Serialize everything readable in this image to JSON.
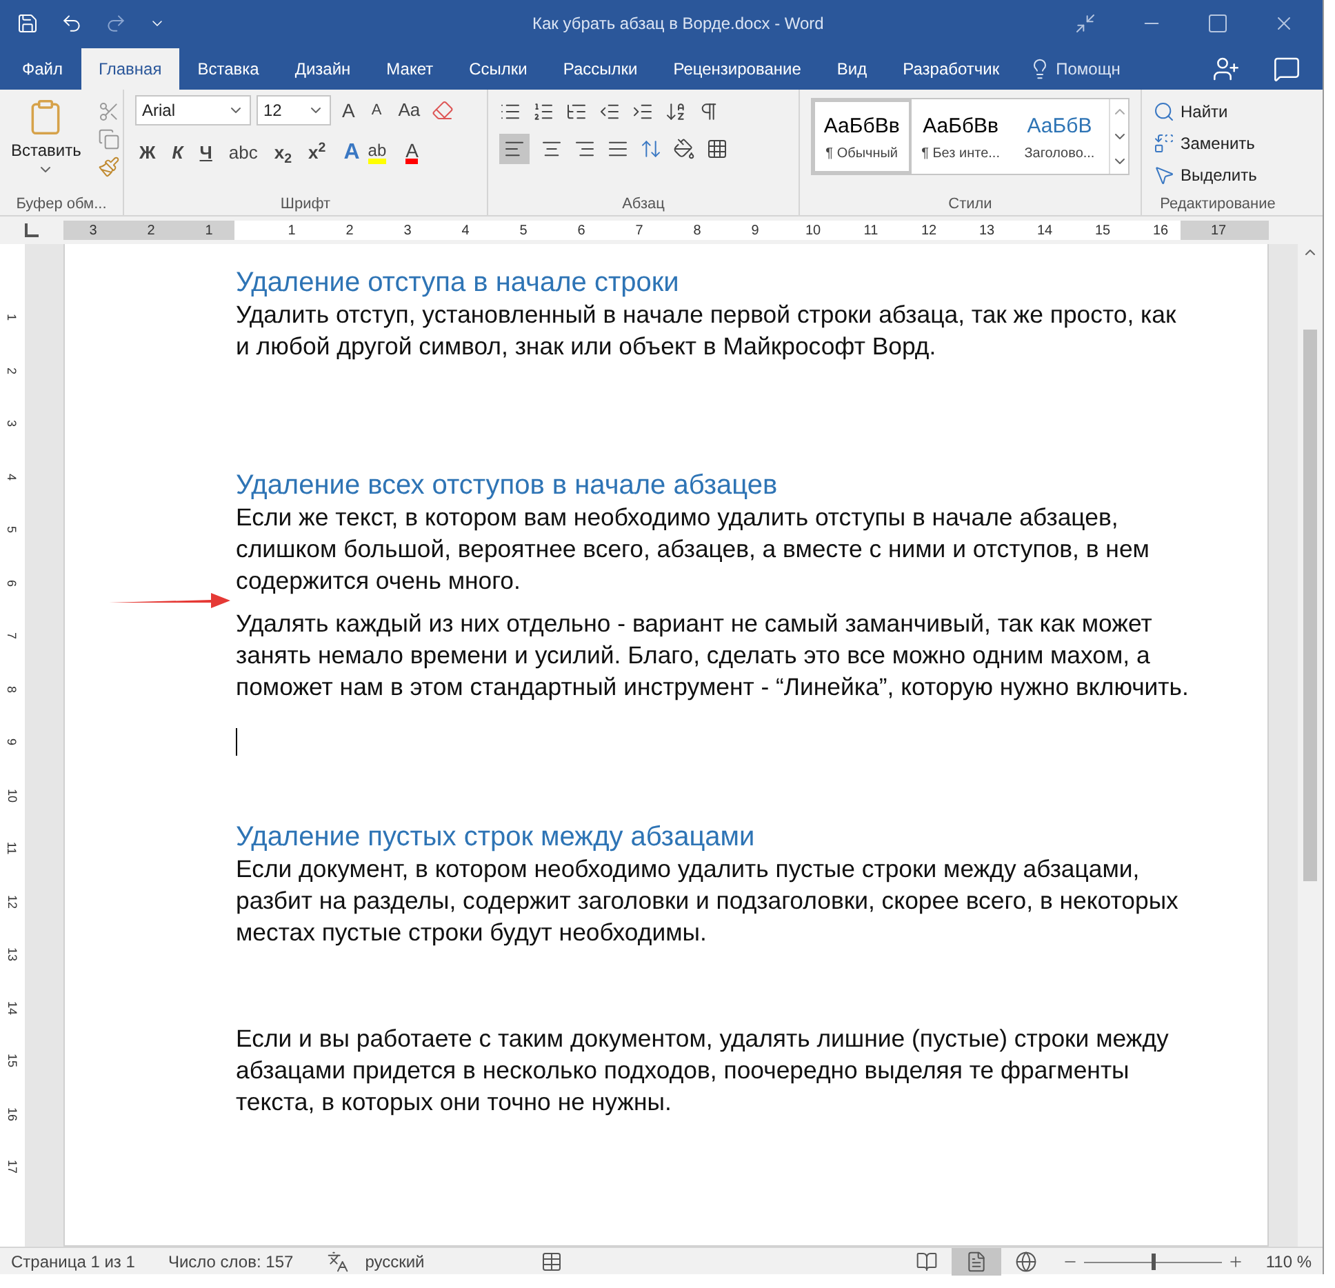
{
  "window": {
    "title": "Как убрать абзац в Ворде.docx - Word"
  },
  "tabs": [
    {
      "label": "Файл",
      "selected": false
    },
    {
      "label": "Главная",
      "selected": true
    },
    {
      "label": "Вставка",
      "selected": false
    },
    {
      "label": "Дизайн",
      "selected": false
    },
    {
      "label": "Макет",
      "selected": false
    },
    {
      "label": "Ссылки",
      "selected": false
    },
    {
      "label": "Рассылки",
      "selected": false
    },
    {
      "label": "Рецензирование",
      "selected": false
    },
    {
      "label": "Вид",
      "selected": false
    },
    {
      "label": "Разработчик",
      "selected": false
    }
  ],
  "tell_me": "Помощн",
  "clipboard": {
    "paste": "Вставить",
    "label": "Буфер обм..."
  },
  "font": {
    "name": "Arial",
    "size": "12",
    "size_buttons": [
      "A",
      "A",
      "Aa"
    ],
    "color_buttons": [
      "A",
      "ab",
      "A"
    ],
    "format_buttons": [
      "Ж",
      "К",
      "Ч",
      "abc",
      "x$_{2}$",
      "x$^{2}$"
    ],
    "label": "Шрифт"
  },
  "paragraph": {
    "label": "Абзац"
  },
  "styles": {
    "label": "Стили",
    "items": [
      {
        "sample": "АаБбВв",
        "name": "¶ Обычный",
        "kind": "normal",
        "selected": true
      },
      {
        "sample": "АаБбВв",
        "name": "¶ Без инте...",
        "kind": "normal",
        "selected": false
      },
      {
        "sample": "АаБбВ",
        "name": "Заголово...",
        "kind": "heading",
        "selected": false
      }
    ]
  },
  "editing": {
    "label": "Редактирование",
    "items": [
      "Найти",
      "Заменить",
      "Выделить"
    ]
  },
  "ruler": [
    "3",
    "2",
    "1",
    "1",
    "2",
    "3",
    "4",
    "5",
    "6",
    "7",
    "8",
    "9",
    "10",
    "11",
    "12",
    "13",
    "14",
    "15",
    "16",
    "17"
  ],
  "vertical_ruler": [
    "1",
    "2",
    "3",
    "4",
    "5",
    "6",
    "7",
    "8",
    "9",
    "10",
    "11",
    "12",
    "13",
    "14",
    "15",
    "16",
    "17"
  ],
  "document": [
    {
      "kind": "heading",
      "text": "Удаление отступа в начале строки"
    },
    {
      "kind": "paragraph",
      "text": "Удалить отступ, установленный в начале первой строки абзаца, так же просто, как и любой другой символ, знак или объект в Майкрософт Ворд.",
      "marked": false
    },
    {
      "kind": "blank"
    },
    {
      "kind": "blank"
    },
    {
      "kind": "blank"
    },
    {
      "kind": "heading",
      "text": "Удаление всех отступов в начале абзацев"
    },
    {
      "kind": "paragraph",
      "text": "Если же текст, в котором вам необходимо удалить отступы в начале абзацев, слишком большой, вероятнее всего, абзацев, а вместе с ними и отступов, в нем содержится очень много.",
      "marked": false
    },
    {
      "kind": "paragraph",
      "text": "Удалять каждый из них отдельно - вариант не самый заманчивый, так как может занять немало времени и усилий. Благо, сделать это все можно одним махом, а поможет нам в этом стандартный инструмент - “Линейка”, которую нужно включить.",
      "marked": true
    },
    {
      "kind": "cursor"
    },
    {
      "kind": "blank"
    },
    {
      "kind": "blank"
    },
    {
      "kind": "heading",
      "text": "Удаление пустых строк между абзацами"
    },
    {
      "kind": "paragraph",
      "text": "Если документ, в котором необходимо удалить пустые строки между абзацами, разбит на разделы, содержит заголовки и подзаголовки, скорее всего, в некоторых местах пустые строки будут необходимы.",
      "marked": false
    },
    {
      "kind": "blank"
    },
    {
      "kind": "blank"
    },
    {
      "kind": "paragraph",
      "text": "Если и вы работаете с таким документом, удалять лишние (пустые) строки между абзацами придется в несколько подходов, поочередно выделяя те фрагменты текста, в которых они точно не нужны.",
      "marked": false
    }
  ],
  "status_bar": {
    "page": "Страница 1 из 1",
    "words": "Число слов: 157",
    "language": "русский",
    "views": [
      {
        "kind": "read",
        "selected": false
      },
      {
        "kind": "print",
        "selected": true
      },
      {
        "kind": "web",
        "selected": false
      }
    ],
    "zoom": {
      "level": 0.5
    },
    "zoom_text": "110 %"
  }
}
